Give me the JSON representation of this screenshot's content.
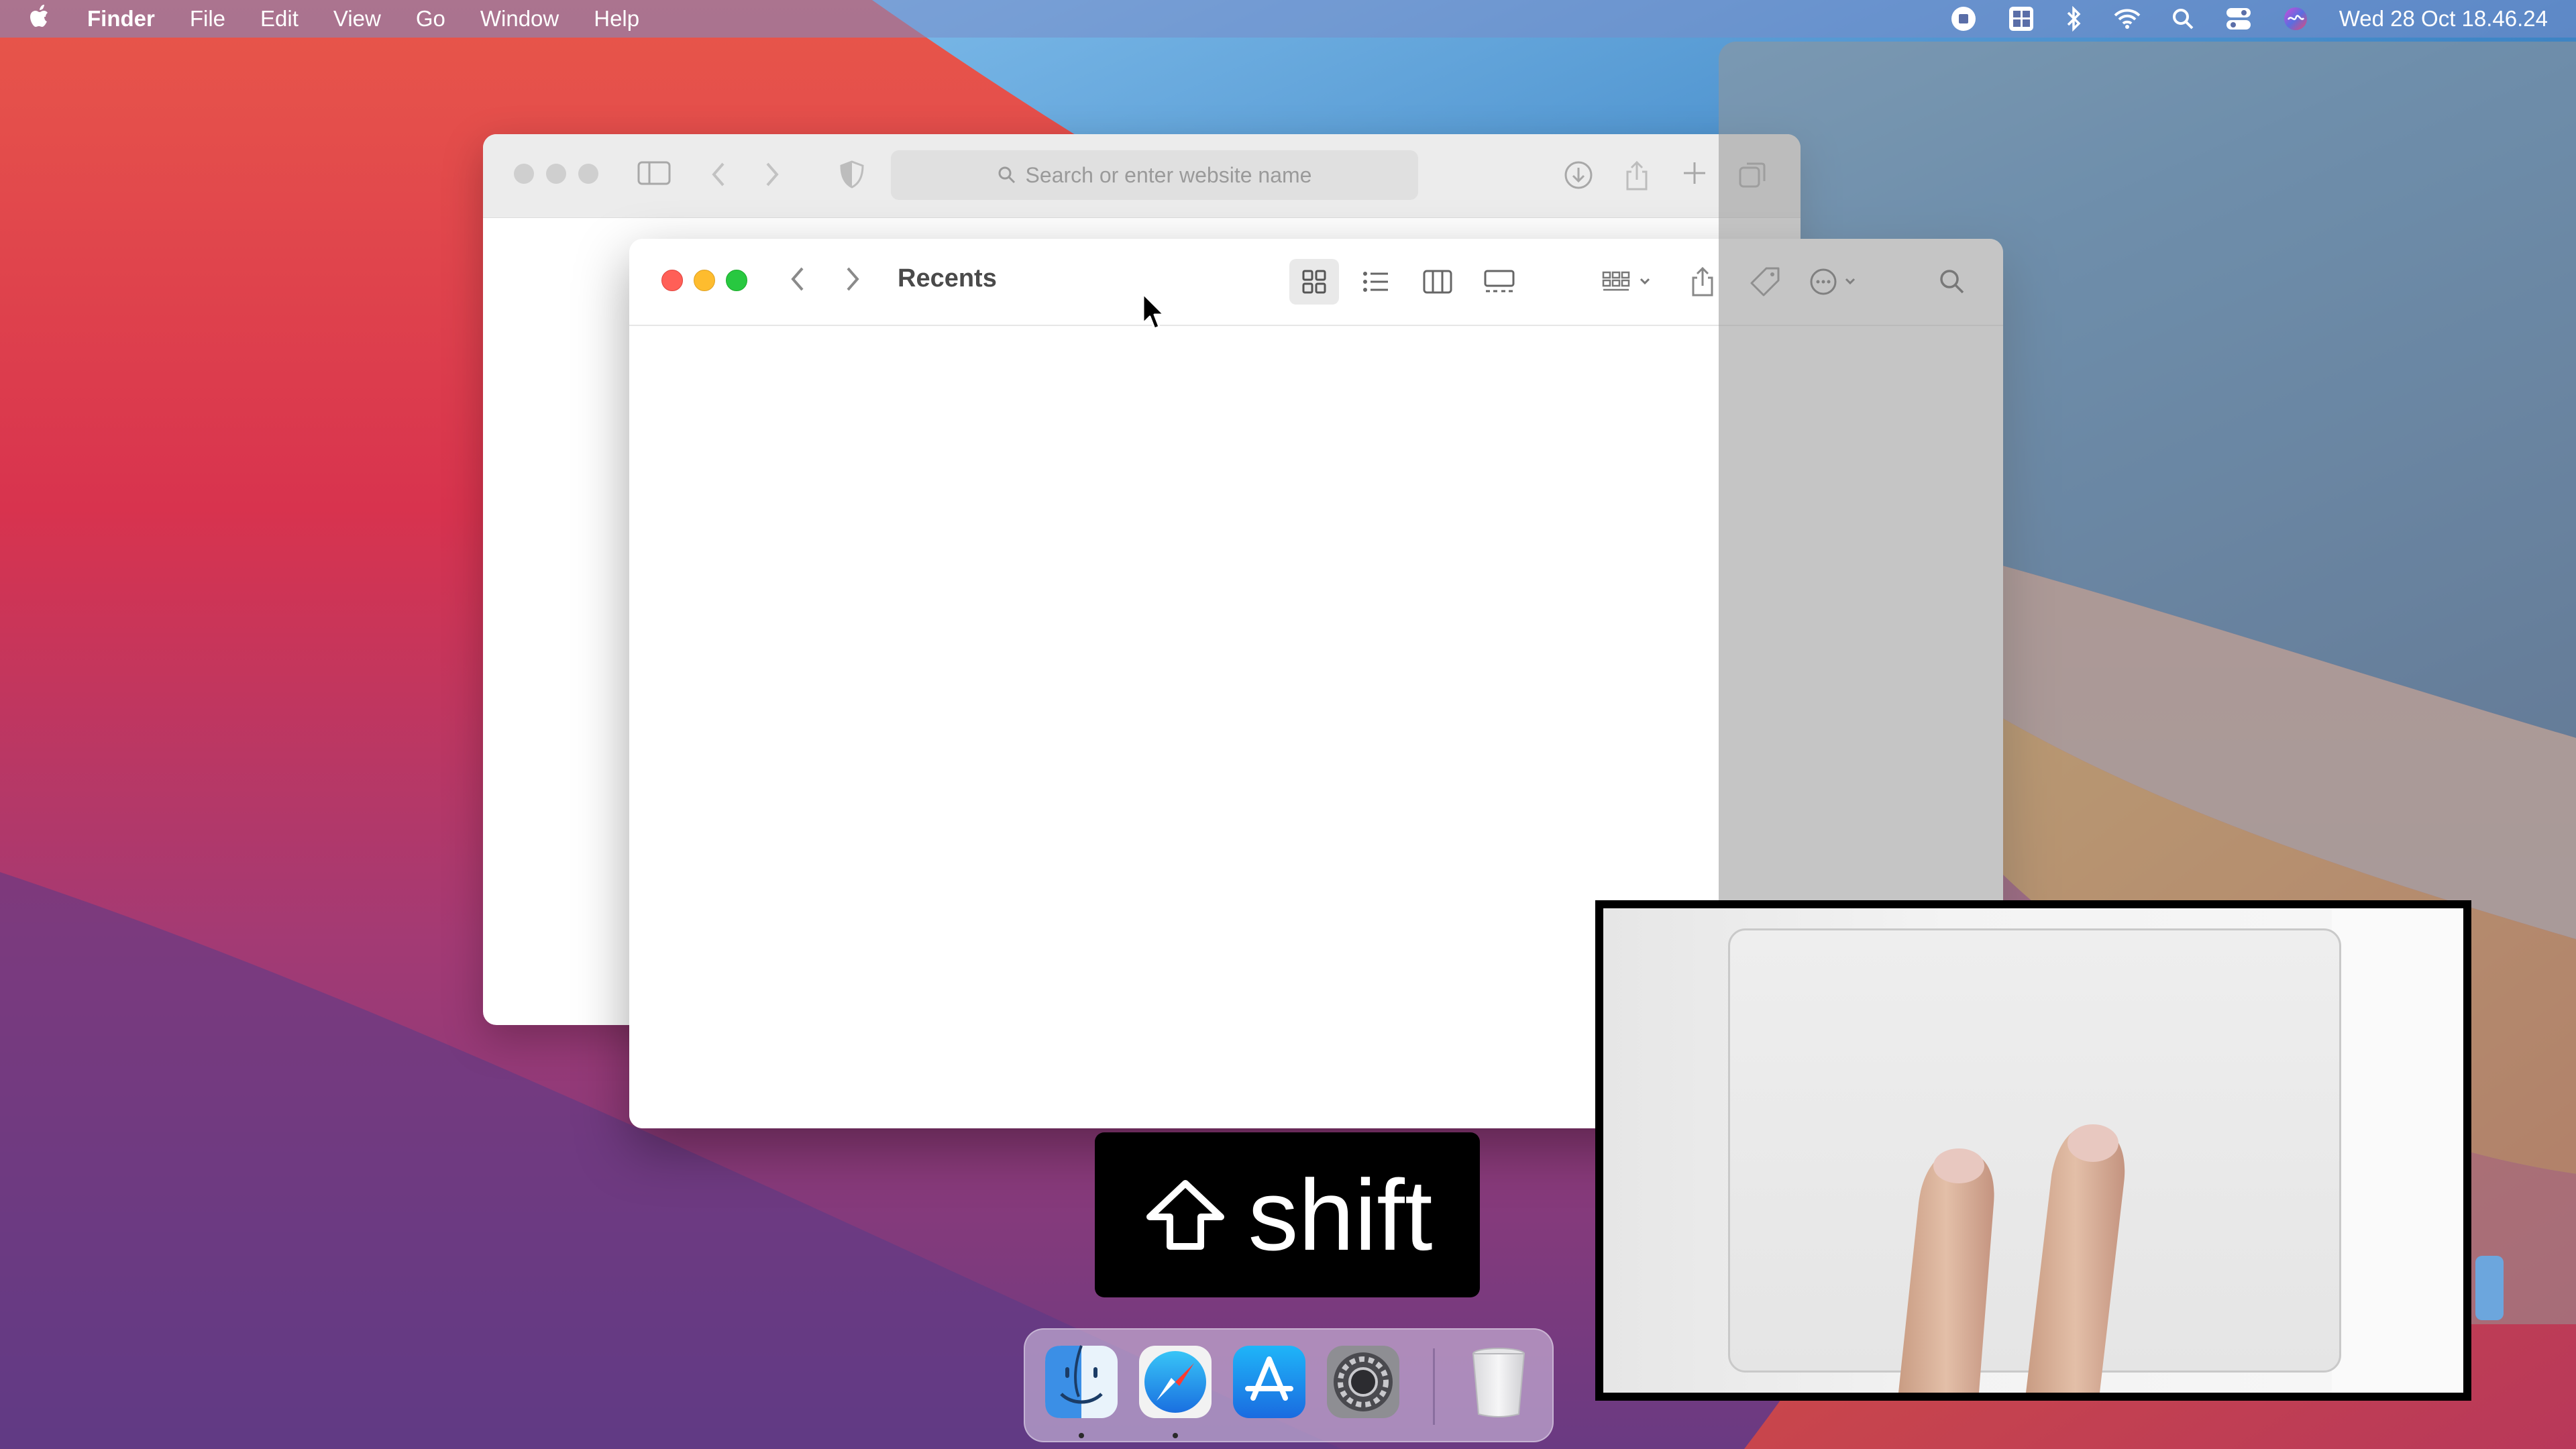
{
  "menubar": {
    "app_name": "Finder",
    "menus": [
      "File",
      "Edit",
      "View",
      "Go",
      "Window",
      "Help"
    ],
    "status_icons": [
      "screen-record-icon",
      "window-tiling-icon",
      "bluetooth-icon",
      "wifi-icon",
      "spotlight-icon",
      "control-center-icon",
      "siri-icon"
    ],
    "clock": "Wed 28 Oct  18.46.24"
  },
  "safari": {
    "url_placeholder": "Search or enter website name"
  },
  "finder": {
    "title": "Recents",
    "view_modes": [
      "icon-view",
      "list-view",
      "column-view",
      "gallery-view"
    ],
    "active_view": "icon-view"
  },
  "keystroke_overlay": {
    "key_symbol": "⇧",
    "key_label": "shift"
  },
  "dock": {
    "apps": [
      "Finder",
      "Safari",
      "App Store",
      "System Preferences",
      "Trash"
    ],
    "running": [
      "Finder",
      "Safari"
    ]
  },
  "colors": {
    "close": "#ff5f57",
    "minimize": "#febc2e",
    "zoom": "#28c840"
  }
}
